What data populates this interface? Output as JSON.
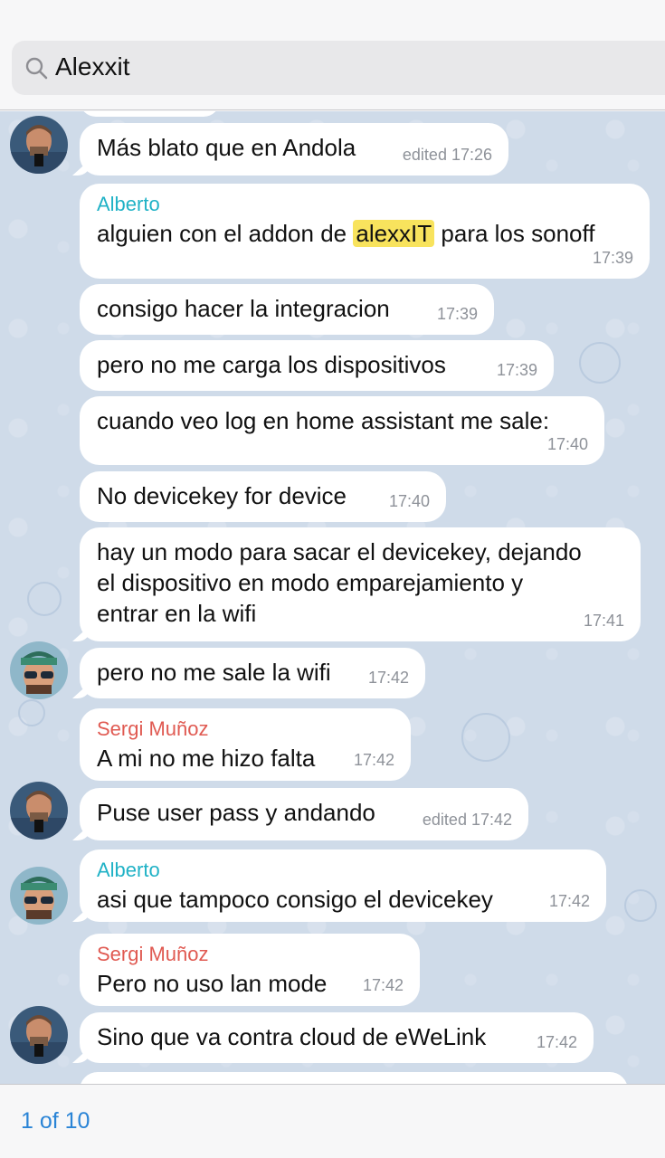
{
  "search": {
    "query": "Alexxit"
  },
  "messages": [
    {
      "text": "Más blato que en Andola",
      "time": "edited 17:26"
    },
    {
      "sender": "Alberto",
      "text_before": "alguien con el addon de ",
      "highlight": "alexxIT",
      "text_after": " para los sonoff",
      "time": "17:39"
    },
    {
      "text": "consigo hacer la integracion",
      "time": "17:39"
    },
    {
      "text": "pero no me carga los dispositivos",
      "time": "17:39"
    },
    {
      "text": "cuando veo log en home assistant me sale:",
      "time": "17:40"
    },
    {
      "text": "No devicekey for device",
      "time": "17:40"
    },
    {
      "lines": [
        "hay un modo para sacar el devicekey, dejando",
        "el dispositivo en modo emparejamiento y",
        "entrar en la wifi"
      ],
      "time": "17:41"
    },
    {
      "text": "pero no me sale la wifi",
      "time": "17:42"
    },
    {
      "sender": "Sergi Muñoz",
      "text": "A mi no me hizo falta",
      "time": "17:42"
    },
    {
      "text": "Puse user pass y andando",
      "time": "edited 17:42"
    },
    {
      "sender": "Alberto",
      "text": "asi que tampoco consigo el devicekey",
      "time": "17:42"
    },
    {
      "sender": "Sergi Muñoz",
      "text": "Pero no uso lan mode",
      "time": "17:42"
    },
    {
      "text": "Sino que va contra cloud de eWeLink",
      "time": "17:42"
    }
  ],
  "footer": {
    "counter": "1 of 10"
  },
  "colors": {
    "accent": "#2a84d6",
    "alberto": "#20b2c6",
    "sergi": "#e05a52",
    "highlight": "#f8e35d",
    "chat_bg": "#cfdbe9"
  }
}
